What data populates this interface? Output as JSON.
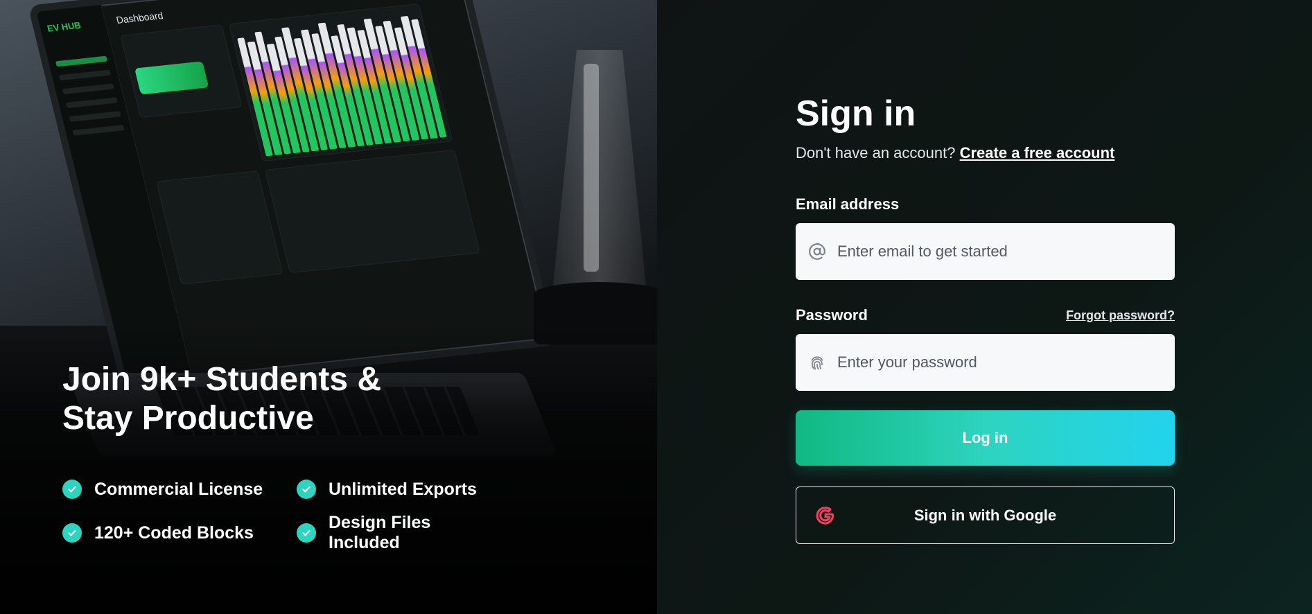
{
  "hero": {
    "title": "Join 9k+ Students & Stay Productive",
    "features": [
      {
        "label": "Commercial License"
      },
      {
        "label": "Unlimited Exports"
      },
      {
        "label": "120+ Coded Blocks"
      },
      {
        "label": "Design Files Included"
      }
    ],
    "laptop_screen": {
      "logo": "EV HUB",
      "title": "Dashboard"
    }
  },
  "signin": {
    "title": "Sign in",
    "subtitle_prefix": "Don't have an account?",
    "create_account_link": "Create a free account",
    "email_label": "Email address",
    "email_placeholder": "Enter email to get started",
    "password_label": "Password",
    "forgot_link": "Forgot password?",
    "password_placeholder": "Enter your password",
    "login_button": "Log in",
    "google_button": "Sign in with Google"
  },
  "colors": {
    "accent_start": "#10b981",
    "accent_end": "#22d3ee",
    "check": "#2dd4bf",
    "google_icon": "#f43f5e"
  },
  "icons": {
    "email": "at-sign-icon",
    "password": "fingerprint-icon",
    "check": "check-circle-icon",
    "google": "google-icon"
  }
}
